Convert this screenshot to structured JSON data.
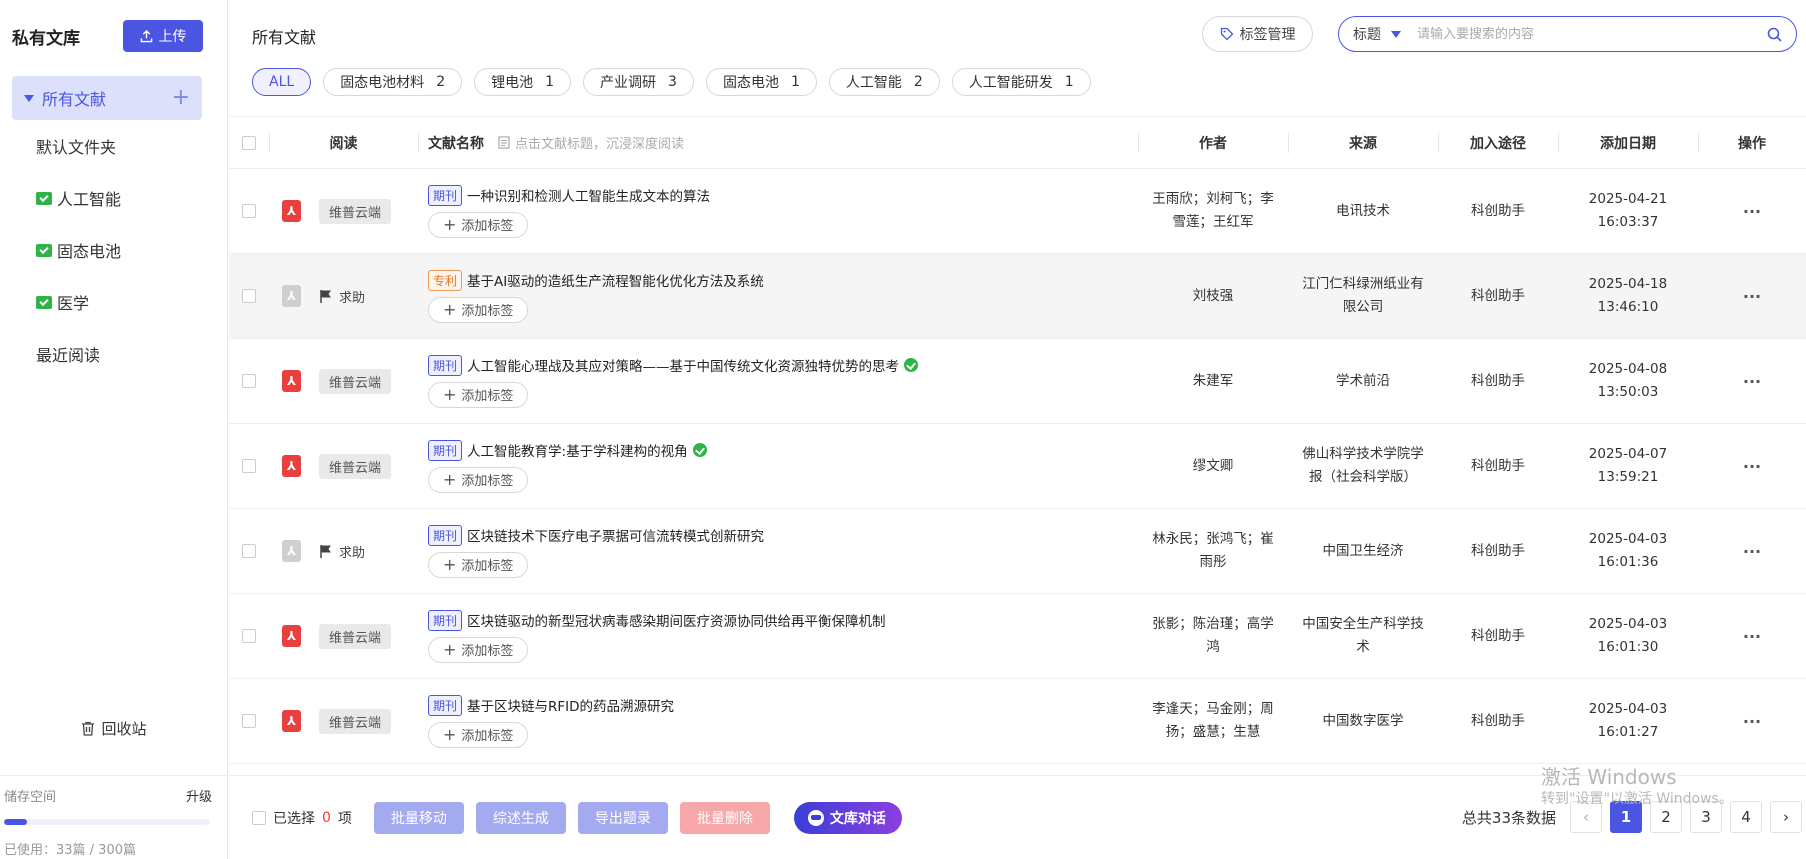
{
  "sidebar": {
    "title": "私有文库",
    "upload_label": "上传",
    "all_label": "所有文献",
    "items": [
      {
        "label": "默认文件夹",
        "folder": false
      },
      {
        "label": "人工智能",
        "folder": true
      },
      {
        "label": "固态电池",
        "folder": true
      },
      {
        "label": "医学",
        "folder": true
      },
      {
        "label": "最近阅读",
        "folder": false
      }
    ],
    "trash_label": "回收站",
    "storage": {
      "label": "储存空间",
      "upgrade": "升级",
      "used_text": "已使用：33篇 / 300篇",
      "used_fraction": 0.11
    }
  },
  "header": {
    "title": "所有文献",
    "tag_manage": "标签管理",
    "search_field": "标题",
    "search_placeholder": "请输入要搜索的内容"
  },
  "chips": [
    {
      "label": "ALL",
      "count": "",
      "active": true
    },
    {
      "label": "固态电池材料",
      "count": "2"
    },
    {
      "label": "锂电池",
      "count": "1"
    },
    {
      "label": "产业调研",
      "count": "3"
    },
    {
      "label": "固态电池",
      "count": "1"
    },
    {
      "label": "人工智能",
      "count": "2"
    },
    {
      "label": "人工智能研发",
      "count": "1"
    }
  ],
  "table": {
    "headers": {
      "read": "阅读",
      "title": "文献名称",
      "hint": "点击文献标题，沉浸深度阅读",
      "author": "作者",
      "source": "来源",
      "via": "加入途径",
      "date": "添加日期",
      "op": "操作"
    },
    "add_tag_label": "添加标签",
    "rows": [
      {
        "read": "维普云端",
        "pdf": "red",
        "type": "期刊",
        "title": "一种识别和检测人工智能生成文本的算法",
        "verified": false,
        "author": "王雨欣；刘柯飞；李雪莲；王红军",
        "source": "电讯技术",
        "via": "科创助手",
        "date": "2025-04-21",
        "time": "16:03:37"
      },
      {
        "read": "求助",
        "pdf": "gray",
        "type": "专利",
        "title": "基于AI驱动的造纸生产流程智能化优化方法及系统",
        "verified": false,
        "author": "刘枝强",
        "source": "江门仁科绿洲纸业有限公司",
        "via": "科创助手",
        "date": "2025-04-18",
        "time": "13:46:10"
      },
      {
        "read": "维普云端",
        "pdf": "red",
        "type": "期刊",
        "title": "人工智能心理战及其应对策略——基于中国传统文化资源独特优势的思考",
        "verified": true,
        "author": "朱建军",
        "source": "学术前沿",
        "via": "科创助手",
        "date": "2025-04-08",
        "time": "13:50:03"
      },
      {
        "read": "维普云端",
        "pdf": "red",
        "type": "期刊",
        "title": "人工智能教育学:基于学科建构的视角",
        "verified": true,
        "author": "缪文卿",
        "source": "佛山科学技术学院学报（社会科学版）",
        "via": "科创助手",
        "date": "2025-04-07",
        "time": "13:59:21"
      },
      {
        "read": "求助",
        "pdf": "gray",
        "type": "期刊",
        "title": "区块链技术下医疗电子票据可信流转模式创新研究",
        "verified": false,
        "author": "林永民；张鸿飞；崔雨彤",
        "source": "中国卫生经济",
        "via": "科创助手",
        "date": "2025-04-03",
        "time": "16:01:36"
      },
      {
        "read": "维普云端",
        "pdf": "red",
        "type": "期刊",
        "title": "区块链驱动的新型冠状病毒感染期间医疗资源协同供给再平衡保障机制",
        "verified": false,
        "author": "张影；陈治瑾；高学鸿",
        "source": "中国安全生产科学技术",
        "via": "科创助手",
        "date": "2025-04-03",
        "time": "16:01:30"
      },
      {
        "read": "维普云端",
        "pdf": "red",
        "type": "期刊",
        "title": "基于区块链与RFID的药品溯源研究",
        "verified": false,
        "author": "李逢天；马金刚；周扬；盛慧；生慧",
        "source": "中国数字医学",
        "via": "科创助手",
        "date": "2025-04-03",
        "time": "16:01:27"
      }
    ]
  },
  "footer": {
    "selected_prefix": "已选择",
    "selected_count": "0",
    "selected_suffix": "项",
    "buttons": [
      "批量移动",
      "综述生成",
      "导出题录",
      "批量删除"
    ],
    "chat_label": "文库对话",
    "total_text": "总共33条数据",
    "pages": [
      "1",
      "2",
      "3",
      "4"
    ],
    "current_page": "1"
  },
  "watermark": {
    "line1": "激活 Windows",
    "line2": "转到\"设置\"以激活 Windows。"
  },
  "colors": {
    "accent": "#4a56e2",
    "pdf_red": "#e8403e",
    "verified_green": "#2fb447",
    "patent_orange": "#e07b2e"
  }
}
